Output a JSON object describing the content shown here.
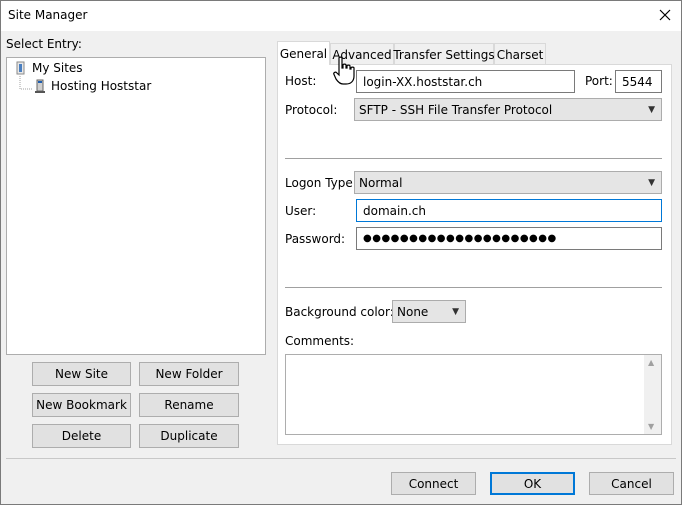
{
  "window": {
    "title": "Site Manager"
  },
  "left": {
    "select_entry_label": "Select Entry:",
    "tree": {
      "root": "My Sites",
      "child": "Hosting Hoststar"
    },
    "buttons": {
      "new_site": "New Site",
      "new_folder": "New Folder",
      "new_bookmark": "New Bookmark",
      "rename": "Rename",
      "delete": "Delete",
      "duplicate": "Duplicate"
    }
  },
  "tabs": [
    {
      "label": "General"
    },
    {
      "label": "Advanced"
    },
    {
      "label": "Transfer Settings"
    },
    {
      "label": "Charset"
    }
  ],
  "general": {
    "host_label": "Host:",
    "host_value": "login-XX.hoststar.ch",
    "port_label": "Port:",
    "port_value": "5544",
    "protocol_label": "Protocol:",
    "protocol_value": "SFTP - SSH File Transfer Protocol",
    "logon_type_label": "Logon Type:",
    "logon_type_value": "Normal",
    "user_label": "User:",
    "user_value": "domain.ch",
    "password_label": "Password:",
    "password_value": "●●●●●●●●●●●●●●●●●●●●●",
    "bg_color_label": "Background color:",
    "bg_color_value": "None",
    "comments_label": "Comments:"
  },
  "footer": {
    "connect": "Connect",
    "ok": "OK",
    "cancel": "Cancel"
  },
  "colors": {
    "accent": "#0078d7",
    "window_bg": "#f0f0f0"
  }
}
